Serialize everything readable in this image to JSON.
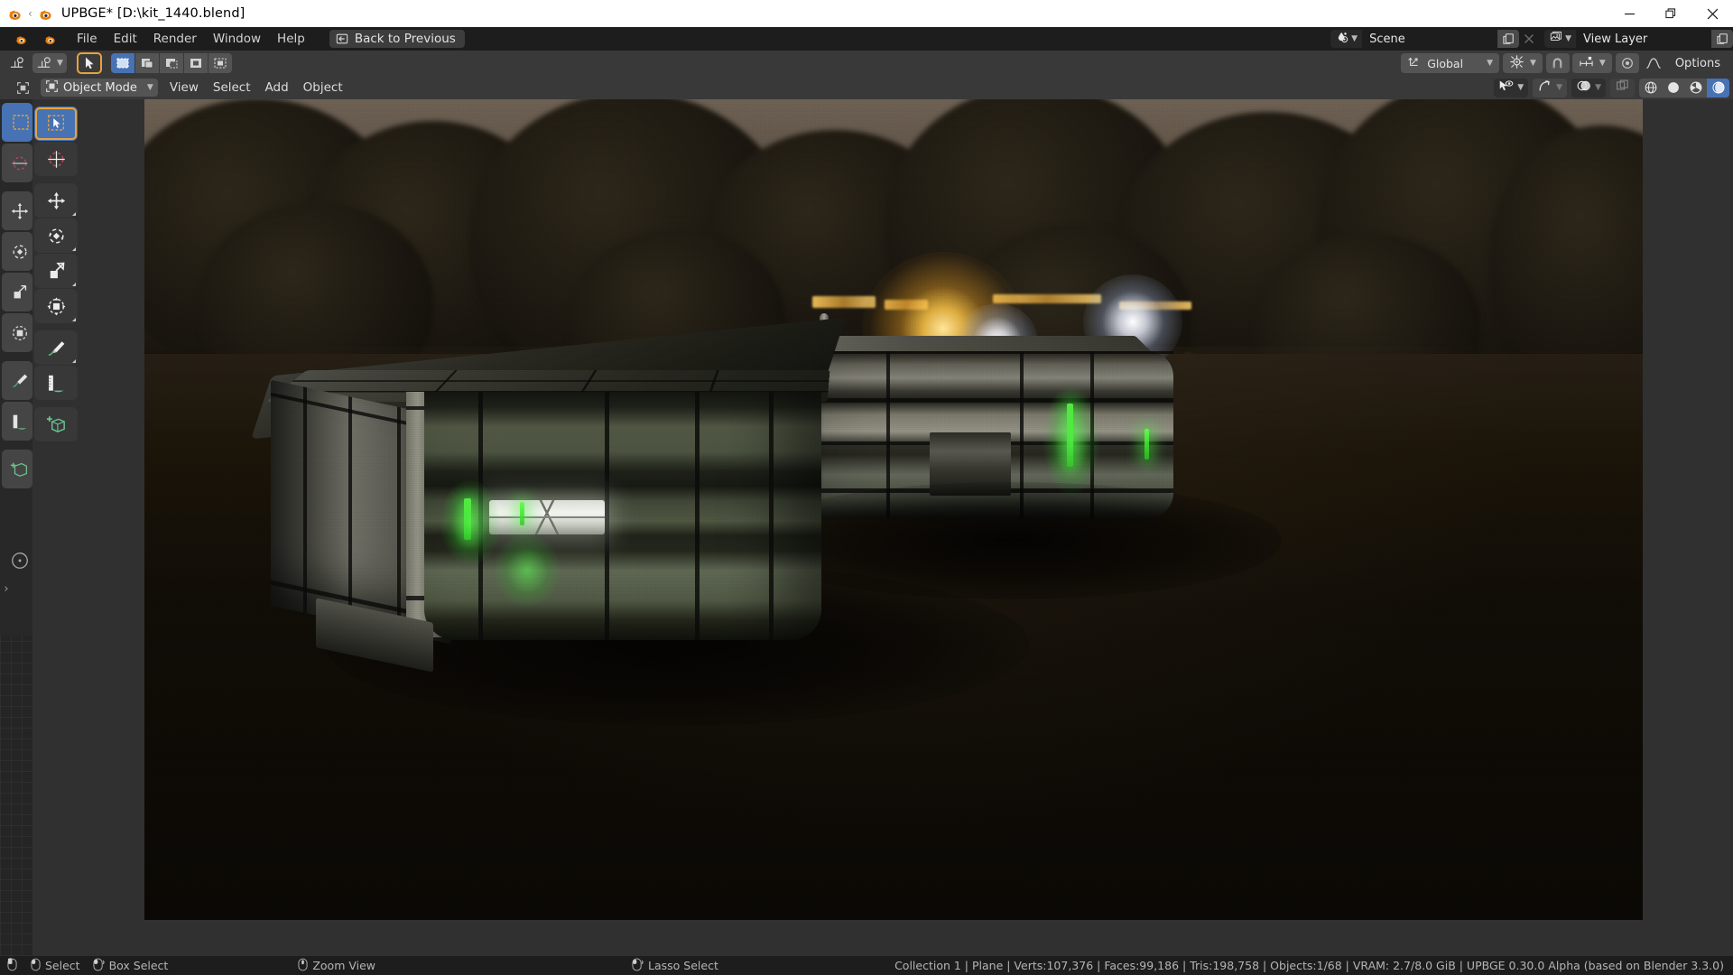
{
  "window": {
    "title": "UPBGE* [D:\\kit_1440.blend]",
    "app_icon": "blender-logo-icon",
    "minimize": "minimize-icon",
    "maximize": "maximize-icon",
    "close": "close-icon"
  },
  "topbar": {
    "menus": [
      {
        "label": "File"
      },
      {
        "label": "Edit"
      },
      {
        "label": "Render"
      },
      {
        "label": "Window"
      },
      {
        "label": "Help"
      }
    ],
    "back_button": {
      "label": "Back to Previous",
      "icon": "back-arrow-icon"
    },
    "scene": {
      "value": "Scene",
      "icon": "scene-icon",
      "new_btn": "new-scene-icon",
      "unlink_btn": "unlink-icon"
    },
    "view_layer": {
      "value": "View Layer",
      "icon": "view-layer-icon",
      "new_btn": "new-view-layer-icon"
    }
  },
  "tool_settings": {
    "active_tool": "tweak-tool",
    "select_modes": [
      "set-select-icon",
      "extend-select-icon",
      "subtract-select-icon",
      "invert-select-icon",
      "intersect-select-icon"
    ],
    "active_select_mode": 0,
    "transform_orientation": {
      "label": "Global",
      "icon": "orientation-icon"
    },
    "pivot_point": {
      "icon": "pivot-point-icon"
    },
    "snap": {
      "icon": "magnet-icon",
      "target_icon": "snap-increment-icon"
    },
    "proportional_editing": {
      "icon": "proportional-edit-icon",
      "falloff_icon": "smooth-falloff-icon"
    },
    "options_label": "Options"
  },
  "viewport": {
    "mode": {
      "label": "Object Mode",
      "icon": "object-mode-icon"
    },
    "menus": [
      {
        "label": "View"
      },
      {
        "label": "Select"
      },
      {
        "label": "Add"
      },
      {
        "label": "Object"
      }
    ],
    "overlays": {
      "visibility_icon": "object-types-visibility-icon",
      "gizmo_icon": "gizmo-icon",
      "overlay_icon": "overlays-icon",
      "xray_icon": "xray-toggle-icon"
    },
    "shading_modes": [
      {
        "name": "wireframe-shading-icon",
        "active": false
      },
      {
        "name": "solid-shading-icon",
        "active": false
      },
      {
        "name": "material-preview-shading-icon",
        "active": false
      },
      {
        "name": "rendered-shading-icon",
        "active": true
      }
    ]
  },
  "toolbar": {
    "items": [
      {
        "name": "tweak-tool",
        "icon": "cursor-arrow-icon",
        "active": true
      },
      {
        "name": "cursor-tool",
        "icon": "3d-cursor-icon",
        "active": false
      },
      {
        "name": "move-tool",
        "icon": "move-arrows-icon",
        "active": false
      },
      {
        "name": "rotate-tool",
        "icon": "rotate-icon",
        "active": false
      },
      {
        "name": "scale-tool",
        "icon": "scale-icon",
        "active": false
      },
      {
        "name": "transform-tool",
        "icon": "transform-icon",
        "active": false
      },
      {
        "name": "annotate-tool",
        "icon": "pencil-icon",
        "active": false
      },
      {
        "name": "measure-tool",
        "icon": "ruler-icon",
        "active": false
      },
      {
        "name": "add-cube-tool",
        "icon": "add-cube-icon",
        "active": false
      }
    ]
  },
  "status_bar": {
    "keymap": [
      {
        "icon": "mouse-left-icon",
        "label": "Select"
      },
      {
        "icon": "mouse-left-drag-icon",
        "label": "Box Select"
      },
      {
        "icon": "mouse-middle-icon",
        "label": "Zoom View"
      },
      {
        "icon": "mouse-left-lasso-icon",
        "label": "Lasso Select"
      }
    ],
    "scene_stats": "Collection 1 | Plane | Verts:107,376 | Faces:99,186 | Tris:198,758 | Objects:1/68 | VRAM: 2.7/8.0 GiB | UPBGE 0.30.0 Alpha (based on Blender 3.3.0)"
  },
  "colors": {
    "accent_blue": "#4772b3",
    "accent_orange": "#e8a33d",
    "header_gray": "#393939",
    "panel_gray": "#303030",
    "topbar_dark": "#1d1d1d",
    "button_gray": "#545454",
    "text_light": "#e4e4e4",
    "green_neon": "#50ff46"
  }
}
